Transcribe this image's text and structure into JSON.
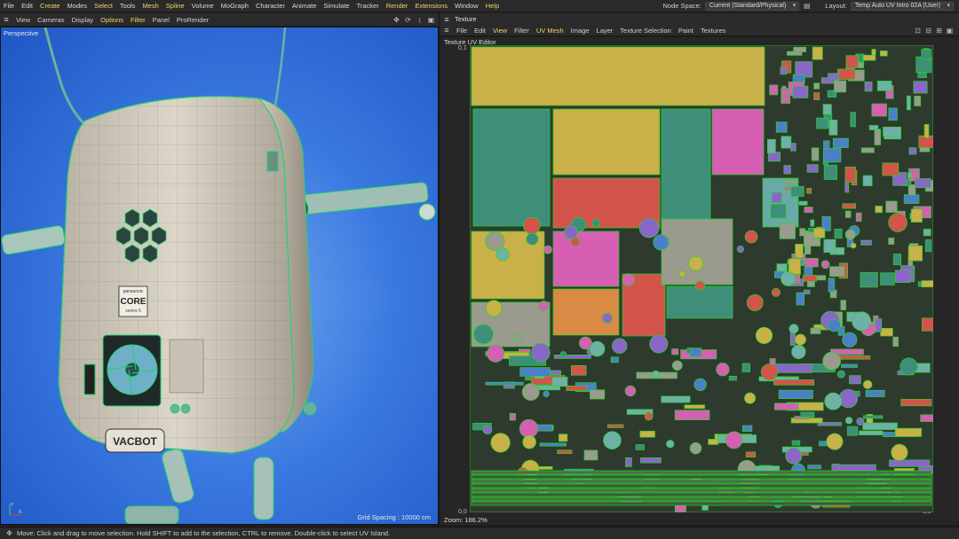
{
  "menu": {
    "items": [
      {
        "label": "File",
        "hl": false
      },
      {
        "label": "Edit",
        "hl": false
      },
      {
        "label": "Create",
        "hl": true
      },
      {
        "label": "Modes",
        "hl": false
      },
      {
        "label": "Select",
        "hl": true
      },
      {
        "label": "Tools",
        "hl": false
      },
      {
        "label": "Mesh",
        "hl": true
      },
      {
        "label": "Spline",
        "hl": true
      },
      {
        "label": "Volume",
        "hl": false
      },
      {
        "label": "MoGraph",
        "hl": false
      },
      {
        "label": "Character",
        "hl": false
      },
      {
        "label": "Animate",
        "hl": false
      },
      {
        "label": "Simulate",
        "hl": false
      },
      {
        "label": "Tracker",
        "hl": false
      },
      {
        "label": "Render",
        "hl": true
      },
      {
        "label": "Extensions",
        "hl": true
      },
      {
        "label": "Window",
        "hl": false
      },
      {
        "label": "Help",
        "hl": true
      }
    ],
    "node_space_label": "Node Space:",
    "node_space_value": "Current (Standard/Physical)",
    "layout_label": "Layout:",
    "layout_value": "Temp Auto UV Intro 02A (User)"
  },
  "viewport": {
    "toolbar": [
      {
        "label": "View",
        "hl": false
      },
      {
        "label": "Cameras",
        "hl": false
      },
      {
        "label": "Display",
        "hl": false
      },
      {
        "label": "Options",
        "hl": true
      },
      {
        "label": "Filter",
        "hl": true
      },
      {
        "label": "Panel",
        "hl": false
      },
      {
        "label": "ProRender",
        "hl": false
      }
    ],
    "camera_label": "Perspective",
    "grid_spacing": "Grid Spacing : 10000 cm",
    "badge_line1": "panasonic",
    "badge_line2": "CORE",
    "badge_line3": "series 5",
    "logo_text": "VACBOT",
    "axis_y": "Y",
    "axis_x": "X"
  },
  "texture": {
    "tab_title": "Texture",
    "toolbar": [
      {
        "label": "File",
        "hl": false
      },
      {
        "label": "Edit",
        "hl": false
      },
      {
        "label": "View",
        "hl": true
      },
      {
        "label": "Filter",
        "hl": false
      },
      {
        "label": "UV Mesh",
        "hl": true
      },
      {
        "label": "Image",
        "hl": false
      },
      {
        "label": "Layer",
        "hl": false
      },
      {
        "label": "Texture Selection",
        "hl": false
      },
      {
        "label": "Paint",
        "hl": false
      },
      {
        "label": "Textures",
        "hl": false
      }
    ],
    "editor_title": "Texture UV Editor",
    "tick_top_left": "0,1",
    "tick_bottom_left": "0,0",
    "tick_bottom_right": "1,0",
    "zoom": "Zoom: 186.2%"
  },
  "status": {
    "message": "Move: Click and drag to move selection. Hold SHIFT to add to the selection, CTRL to remove. Double-click to select UV Island."
  },
  "colors": {
    "uv_wire": "#22d822",
    "island_yellow": "#c9b049",
    "island_red": "#d2544a",
    "island_magenta": "#d65fb4",
    "island_teal": "#3e8e7a",
    "island_purple": "#8b66c9",
    "island_grey": "#9a9a8f",
    "viewport_blue": "#3a79e0"
  }
}
